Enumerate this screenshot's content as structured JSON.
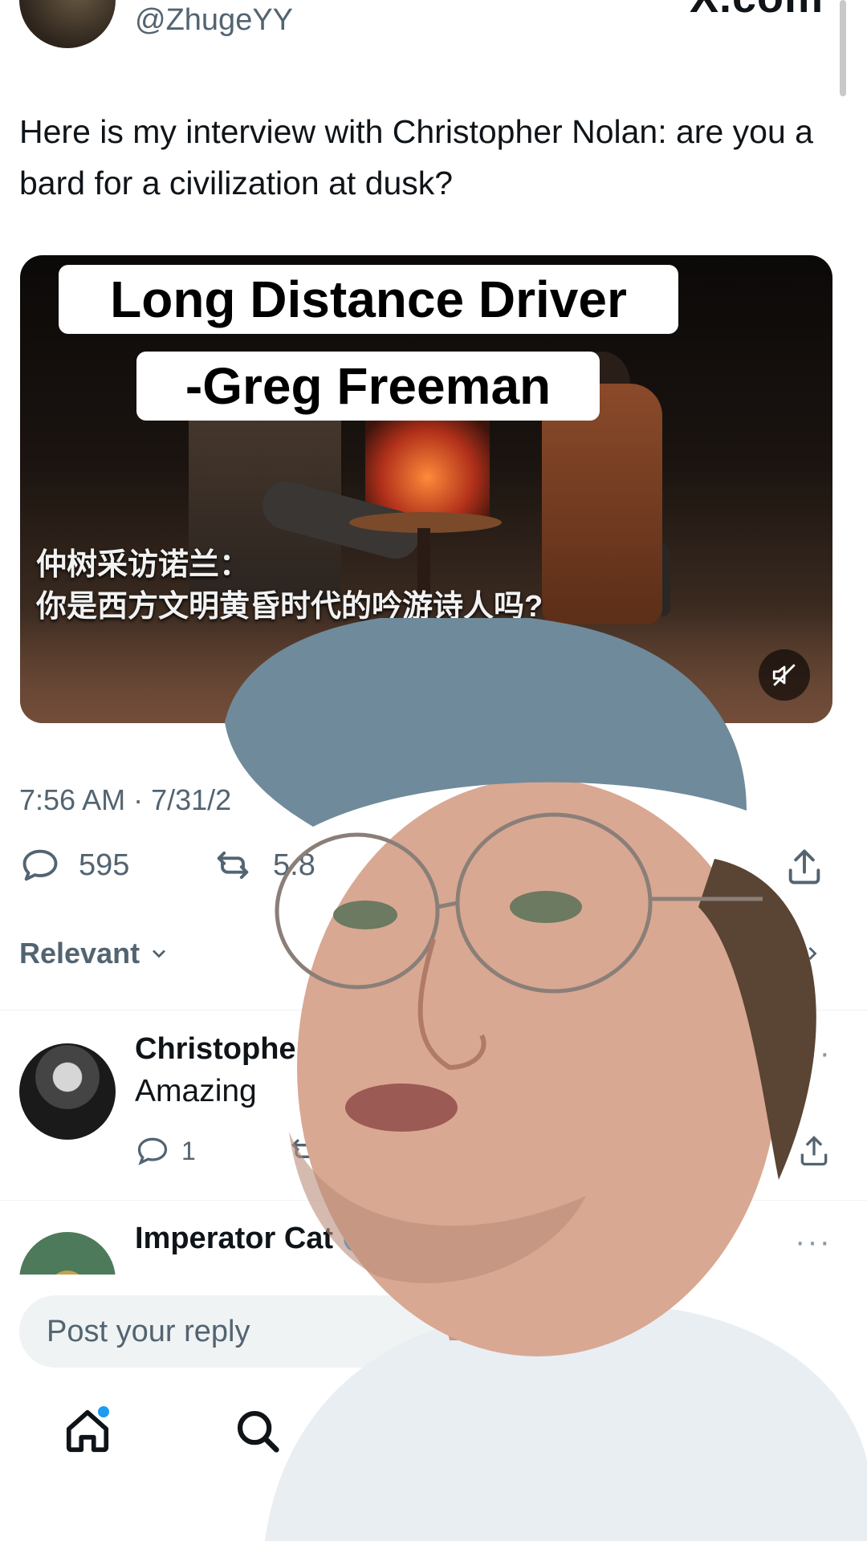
{
  "header": {
    "handle": "@ZhugeYY",
    "site": "X.com"
  },
  "tweet": {
    "text": "Here is my interview with Christopher Nolan: are you a bard for a civilization at dusk?",
    "media": {
      "subtitle_line1": "仲树采访诺兰：",
      "subtitle_line2": "你是西方文明黄昏时代的吟游诗人吗?"
    },
    "timestamp": "7:56 AM · 7/31/2",
    "metrics": {
      "replies": "595",
      "reposts": "5.8"
    }
  },
  "overlay_caption": {
    "line1": "Long Distance Driver",
    "line2": "-Greg Freeman"
  },
  "sort": {
    "label": "Relevant",
    "right_label": "es"
  },
  "replies": [
    {
      "name": "Christopher",
      "text": "Amazing",
      "reply_count": "1"
    },
    {
      "name": "Imperator Cat",
      "text": "",
      "verified": true
    }
  ],
  "compose": {
    "placeholder": "Post your reply"
  },
  "colors": {
    "accent": "#1d9bf0",
    "text": "#0f1419",
    "muted": "#536471"
  }
}
